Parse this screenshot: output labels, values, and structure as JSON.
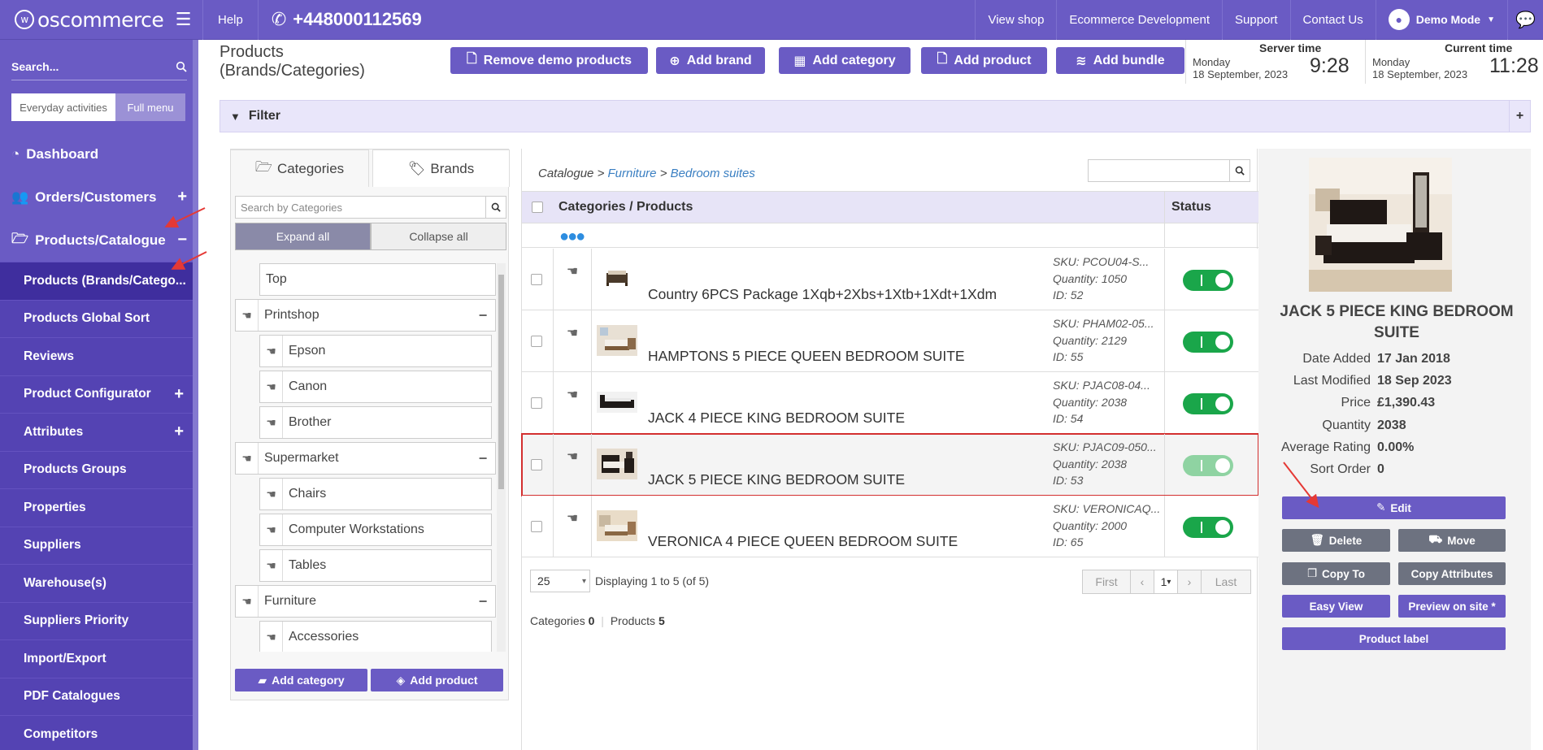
{
  "topbar": {
    "logo": "oscommerce",
    "help": "Help",
    "phone": "+448000112569",
    "links": [
      "View shop",
      "Ecommerce Development",
      "Support",
      "Contact Us"
    ],
    "user": "Demo Mode"
  },
  "sidebar": {
    "search_placeholder": "Search...",
    "mode_everyday": "Everyday activities",
    "mode_full": "Full menu",
    "items": [
      {
        "label": "Dashboard"
      },
      {
        "label": "Orders/Customers"
      },
      {
        "label": "Products/Catalogue"
      }
    ],
    "subitems": [
      {
        "label": "Products (Brands/Catego..."
      },
      {
        "label": "Products Global Sort"
      },
      {
        "label": "Reviews"
      },
      {
        "label": "Product Configurator"
      },
      {
        "label": "Attributes"
      },
      {
        "label": "Products Groups"
      },
      {
        "label": "Properties"
      },
      {
        "label": "Suppliers"
      },
      {
        "label": "Warehouse(s)"
      },
      {
        "label": "Suppliers Priority"
      },
      {
        "label": "Import/Export"
      },
      {
        "label": "PDF Catalogues"
      },
      {
        "label": "Competitors"
      }
    ]
  },
  "header": {
    "title": "Products (Brands/Categories)",
    "buttons": {
      "remove_demo": "Remove demo products",
      "add_brand": "Add brand",
      "add_category": "Add category",
      "add_product": "Add product",
      "add_bundle": "Add bundle"
    },
    "server_time": {
      "label": "Server time",
      "day": "Monday",
      "date": "18 September, 2023",
      "time": "9:28"
    },
    "current_time": {
      "label": "Current time",
      "day": "Monday",
      "date": "18 September, 2023",
      "time": "11:28"
    }
  },
  "filter": {
    "label": "Filter",
    "plus": "+"
  },
  "categories": {
    "tab_categories": "Categories",
    "tab_brands": "Brands",
    "search_placeholder": "Search by Categories",
    "expand_all": "Expand all",
    "collapse_all": "Collapse all",
    "tree": [
      "Top",
      "Printshop",
      "Epson",
      "Canon",
      "Brother",
      "Supermarket",
      "Chairs",
      "Computer Workstations",
      "Tables",
      "Furniture",
      "Accessories"
    ],
    "add_category": "Add category",
    "add_product": "Add product"
  },
  "grid": {
    "breadcrumb": {
      "root": "Catalogue",
      "sep": ">",
      "level1": "Furniture",
      "level2": "Bedroom suites"
    },
    "col_name": "Categories / Products",
    "col_status": "Status",
    "rows": [
      {
        "name": "Country 6PCS Package 1Xqb+2Xbs+1Xtb+1Xdt+1Xdm",
        "sku": "SKU: PCOU04-S...",
        "qty": "Quantity: 1050",
        "id": "ID: 52"
      },
      {
        "name": "HAMPTONS 5 PIECE QUEEN BEDROOM SUITE",
        "sku": "SKU: PHAM02-05...",
        "qty": "Quantity: 2129",
        "id": "ID: 55"
      },
      {
        "name": "JACK 4 PIECE KING BEDROOM SUITE",
        "sku": "SKU: PJAC08-04...",
        "qty": "Quantity: 2038",
        "id": "ID: 54"
      },
      {
        "name": "JACK 5 PIECE KING BEDROOM SUITE",
        "sku": "SKU: PJAC09-050...",
        "qty": "Quantity: 2038",
        "id": "ID: 53"
      },
      {
        "name": "VERONICA 4 PIECE QUEEN BEDROOM SUITE",
        "sku": "SKU: VERONICAQ...",
        "qty": "Quantity: 2000",
        "id": "ID: 65"
      }
    ],
    "per_page": "25",
    "displaying": "Displaying 1 to 5 (of 5)",
    "pager": {
      "first": "First",
      "page": "1",
      "last": "Last"
    },
    "counts": {
      "categories_label": "Categories",
      "categories": "0",
      "products_label": "Products",
      "products": "5"
    }
  },
  "detail": {
    "title": "JACK 5 PIECE KING BEDROOM SUITE",
    "fields": [
      {
        "k": "Date Added",
        "v": "17 Jan 2018"
      },
      {
        "k": "Last Modified",
        "v": "18 Sep 2023"
      },
      {
        "k": "Price",
        "v": "£1,390.43"
      },
      {
        "k": "Quantity",
        "v": "2038"
      },
      {
        "k": "Average Rating",
        "v": "0.00%"
      },
      {
        "k": "Sort Order",
        "v": "0"
      }
    ],
    "buttons": {
      "edit": "Edit",
      "delete": "Delete",
      "move": "Move",
      "copy_to": "Copy To",
      "copy_attributes": "Copy Attributes",
      "easy_view": "Easy View",
      "preview": "Preview on site *",
      "product_label": "Product label"
    }
  },
  "colors": {
    "brand": "#6a5bc4",
    "toggle_on": "#1aa64a",
    "highlight": "#d32f2f",
    "link": "#3a7fc2"
  }
}
